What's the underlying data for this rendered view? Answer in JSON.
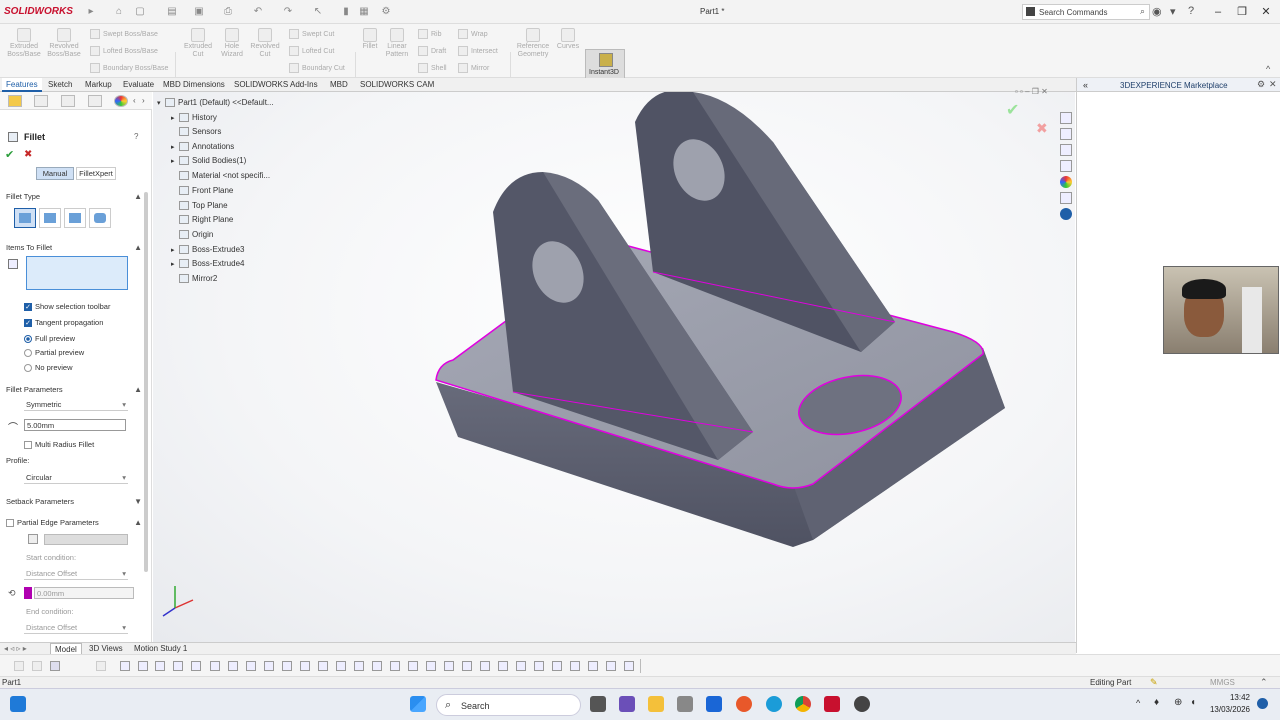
{
  "title_bar": {
    "app_logo": "SOLIDWORKS",
    "doc_title": "Part1 *",
    "search_placeholder": "Search Commands"
  },
  "command_bar": {
    "extruded_boss": "Extruded Boss/Base",
    "revolved_boss": "Revolved Boss/Base",
    "swept_boss": "Swept Boss/Base",
    "lofted_boss": "Lofted Boss/Base",
    "boundary_boss": "Boundary Boss/Base",
    "extruded_cut": "Extruded Cut",
    "hole_wizard": "Hole Wizard",
    "revolved_cut": "Revolved Cut",
    "swept_cut": "Swept Cut",
    "lofted_cut": "Lofted Cut",
    "boundary_cut": "Boundary Cut",
    "fillet": "Fillet",
    "linear_pattern": "Linear Pattern",
    "rib": "Rib",
    "draft": "Draft",
    "shell": "Shell",
    "wrap": "Wrap",
    "intersect": "Intersect",
    "mirror": "Mirror",
    "reference_geometry": "Reference Geometry",
    "curves": "Curves",
    "instant3d": "Instant3D"
  },
  "tabs": [
    "Features",
    "Sketch",
    "Markup",
    "Evaluate",
    "MBD Dimensions",
    "SOLIDWORKS Add-Ins",
    "MBD",
    "SOLIDWORKS CAM"
  ],
  "fillet_panel": {
    "title": "Fillet",
    "mode_manual": "Manual",
    "mode_filletxpert": "FilletXpert",
    "fillet_type_label": "Fillet Type",
    "items_label": "Items To Fillet",
    "show_selection_toolbar": "Show selection toolbar",
    "tangent_propagation": "Tangent propagation",
    "full_preview": "Full preview",
    "partial_preview": "Partial preview",
    "no_preview": "No preview",
    "fillet_params_label": "Fillet Parameters",
    "symmetric": "Symmetric",
    "radius": "5.00mm",
    "multi_radius": "Multi Radius Fillet",
    "profile_label": "Profile:",
    "profile_value": "Circular",
    "setback_label": "Setback Parameters",
    "partial_edge_label": "Partial Edge Parameters",
    "start_condition": "Start condition:",
    "distance_offset_1": "Distance Offset",
    "offset_value": "0.00mm",
    "end_condition": "End condition:",
    "distance_offset_2": "Distance Offset"
  },
  "feature_tree": {
    "root": "Part1 (Default) <<Default...",
    "items": [
      "History",
      "Sensors",
      "Annotations",
      "Solid Bodies(1)",
      "Material <not specifi...",
      "Front Plane",
      "Top Plane",
      "Right Plane",
      "Origin",
      "Boss-Extrude3",
      "Boss-Extrude4",
      "Mirror2"
    ]
  },
  "right_panel": {
    "title": "3DEXPERIENCE Marketplace"
  },
  "bottom_tabs": [
    "Model",
    "3D Views",
    "Motion Study 1"
  ],
  "status_bar": {
    "left": "Part1",
    "editing": "Editing Part",
    "units": "MMGS"
  },
  "taskbar": {
    "search": "Search",
    "time": "13:42",
    "date": "13/03/2026"
  },
  "colors": {
    "accent": "#1f5fa8",
    "highlight_edge": "#e000e0",
    "part_body": "#8a8e9c"
  }
}
